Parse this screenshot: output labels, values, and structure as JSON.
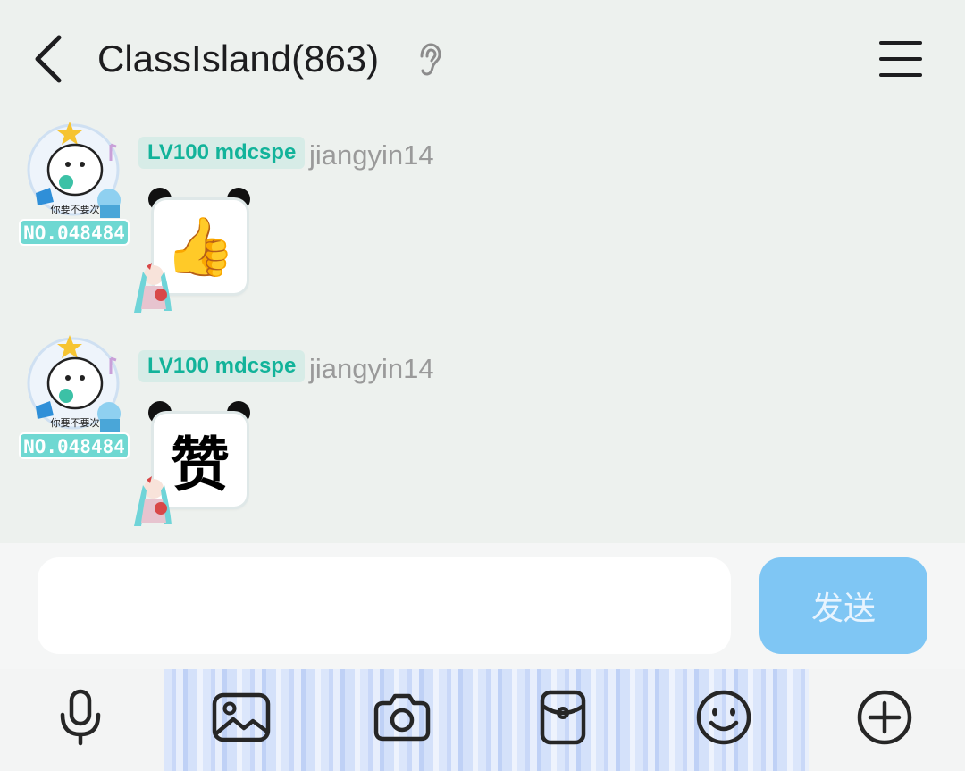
{
  "header": {
    "title": "ClassIsland(863)",
    "back_icon": "chevron-left-icon",
    "ear_icon": "ear-icon",
    "menu_icon": "hamburger-menu-icon"
  },
  "messages": [
    {
      "level_badge": "LV100 mdcspe",
      "username": "jiangyin14",
      "avatar_label": "你要不要次",
      "avatar_number": "NO.048484",
      "sticker_type": "thumbs-up",
      "sticker_content": "👍"
    },
    {
      "level_badge": "LV100 mdcspe",
      "username": "jiangyin14",
      "avatar_label": "你要不要次",
      "avatar_number": "NO.048484",
      "sticker_type": "text",
      "sticker_content": "赞"
    }
  ],
  "input": {
    "value": "",
    "placeholder": "",
    "send_label": "发送"
  },
  "toolbar": {
    "items": [
      "microphone-icon",
      "image-icon",
      "camera-icon",
      "red-packet-icon",
      "emoji-icon",
      "plus-circle-icon"
    ]
  },
  "colors": {
    "background": "#edf1ee",
    "badge_text": "#12b39a",
    "send_button": "#7fc6f4"
  }
}
